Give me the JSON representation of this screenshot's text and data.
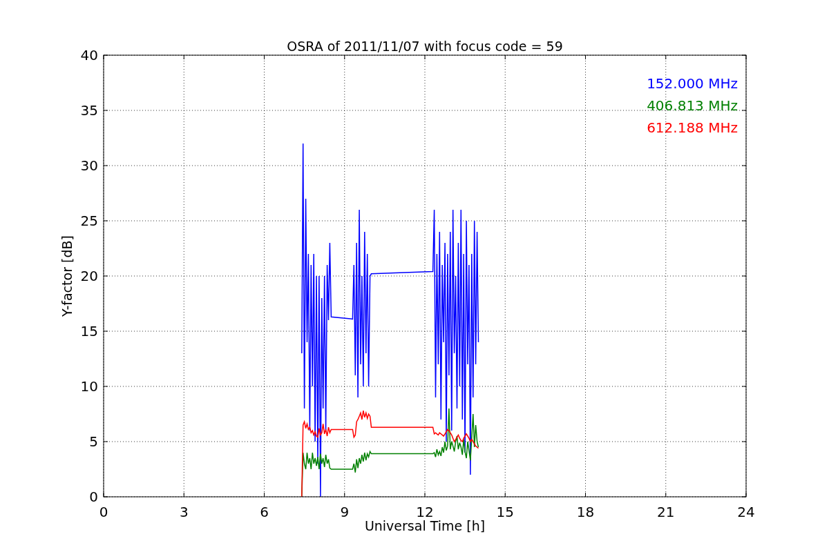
{
  "chart_data": {
    "type": "line",
    "title": "OSRA of 2011/11/07 with focus code = 59",
    "xlabel": "Universal Time [h]",
    "ylabel": "Y-factor [dB]",
    "x": [
      7.4,
      7.45,
      7.5,
      7.55,
      7.6,
      7.65,
      7.7,
      7.75,
      7.8,
      7.85,
      7.9,
      7.95,
      8.0,
      8.05,
      8.1,
      8.15,
      8.2,
      8.25,
      8.3,
      8.35,
      8.4,
      8.45,
      8.5,
      9.3,
      9.35,
      9.4,
      9.45,
      9.5,
      9.55,
      9.6,
      9.65,
      9.7,
      9.75,
      9.8,
      9.85,
      9.9,
      9.95,
      10.0,
      12.3,
      12.35,
      12.4,
      12.45,
      12.5,
      12.55,
      12.6,
      12.65,
      12.7,
      12.75,
      12.8,
      12.85,
      12.9,
      12.95,
      13.0,
      13.05,
      13.1,
      13.15,
      13.2,
      13.25,
      13.3,
      13.35,
      13.4,
      13.45,
      13.5,
      13.55,
      13.6,
      13.65,
      13.7,
      13.75,
      13.8,
      13.85,
      13.9,
      13.95,
      14.0
    ],
    "series": [
      {
        "name": "152.000 MHz",
        "color": "#0000ff",
        "values": [
          13,
          32,
          8,
          27,
          14,
          22,
          6,
          21,
          10,
          22,
          5,
          20,
          3,
          20,
          0,
          18,
          8,
          20,
          6,
          21,
          16,
          23,
          16.3,
          16.1,
          21,
          11,
          23,
          9,
          26,
          12,
          20,
          10,
          24,
          13,
          22,
          10,
          20,
          20.2,
          20.4,
          26,
          9,
          22,
          12,
          24,
          7,
          21,
          14,
          23,
          5,
          22,
          11,
          24,
          6,
          26,
          13,
          20,
          8,
          23,
          10,
          26,
          7,
          22,
          4,
          25,
          12,
          21,
          2,
          22,
          9,
          25,
          12,
          24,
          14
        ]
      },
      {
        "name": "406.813 MHz",
        "color": "#008000",
        "values": [
          0,
          4,
          3,
          2.5,
          4,
          3,
          3.5,
          2.5,
          4,
          3,
          3.5,
          2.8,
          3.6,
          2.5,
          3.9,
          3,
          3.5,
          2.7,
          3.8,
          3,
          3.4,
          2.6,
          2.5,
          2.5,
          3,
          2.2,
          3.4,
          2.6,
          3.5,
          3,
          3.8,
          3.2,
          4,
          3.3,
          3.9,
          3.6,
          4.1,
          3.9,
          3.9,
          4,
          3.6,
          4.3,
          3.8,
          4.1,
          3.7,
          4.5,
          4,
          5,
          4.2,
          4.6,
          8,
          4.3,
          5,
          4.6,
          4.1,
          5,
          5.5,
          4.3,
          4.9,
          4.5,
          3.8,
          5.2,
          4.1,
          3.5,
          5,
          4.2,
          3.3,
          5.3,
          7.5,
          4.5,
          6.5,
          5,
          4.5
        ]
      },
      {
        "name": "612.188 MHz",
        "color": "#ff0000",
        "values": [
          0,
          6.5,
          6.8,
          6.2,
          6.6,
          6.1,
          6.3,
          5.8,
          6,
          5.6,
          5.9,
          5.5,
          5.4,
          6.2,
          5.6,
          5.8,
          6.6,
          5.7,
          6.1,
          5.5,
          6.3,
          5.8,
          6.1,
          6.1,
          5.4,
          5.6,
          6.8,
          7,
          7.3,
          7.6,
          7,
          7.8,
          7.2,
          7.6,
          7.1,
          7.5,
          7.3,
          6.3,
          6.3,
          5.7,
          5.8,
          5.7,
          5.6,
          5.8,
          5.7,
          5.6,
          5.5,
          5.7,
          5.9,
          6.1,
          6.0,
          5.8,
          5.6,
          5.3,
          5.0,
          5.2,
          5.4,
          5.6,
          5.3,
          5.1,
          5.0,
          5.3,
          5.5,
          5.7,
          5.5,
          5.3,
          5.0,
          5.2,
          5.0,
          4.8,
          4.6,
          4.5,
          4.4
        ]
      }
    ],
    "xlim": [
      0,
      24
    ],
    "ylim": [
      0,
      40
    ],
    "xticks": [
      0,
      3,
      6,
      9,
      12,
      15,
      18,
      21,
      24
    ],
    "yticks": [
      0,
      5,
      10,
      15,
      20,
      25,
      30,
      35,
      40
    ],
    "grid": true
  }
}
